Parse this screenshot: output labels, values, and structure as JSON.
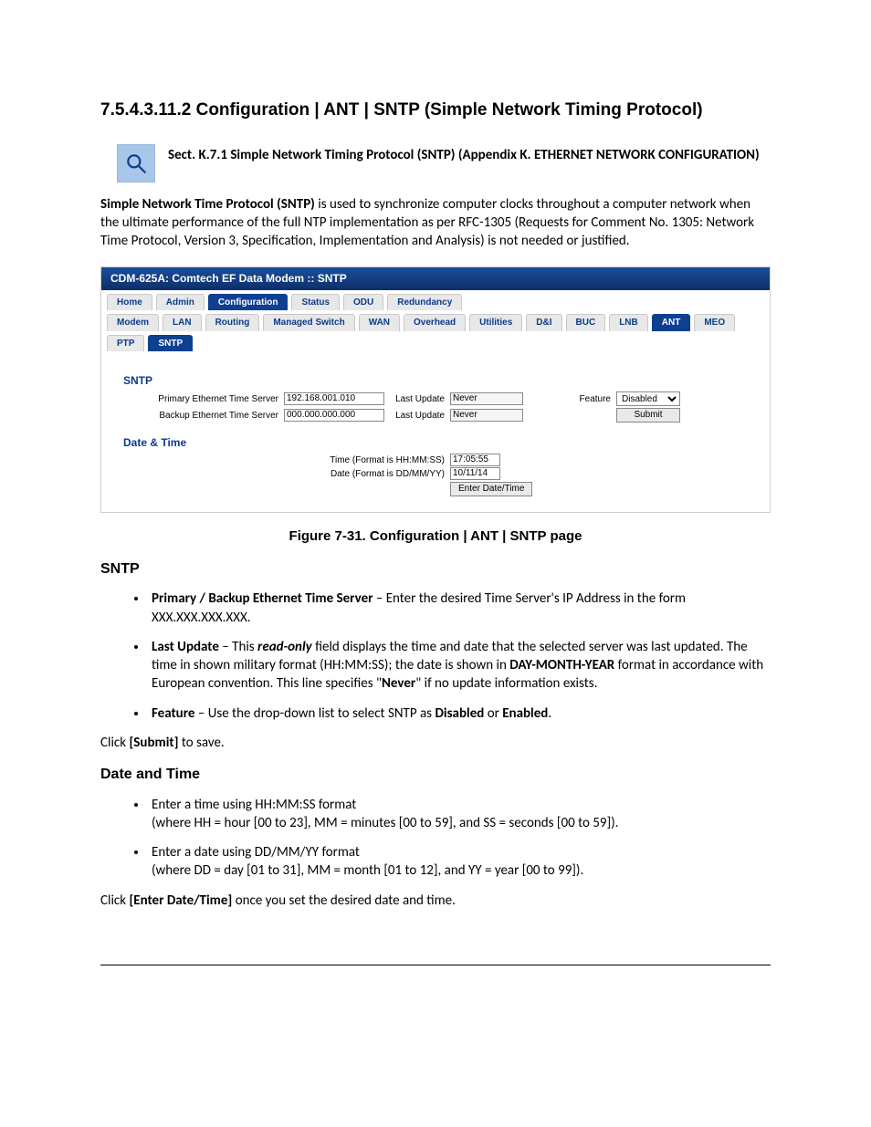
{
  "heading": "7.5.4.3.11.2 Configuration | ANT | SNTP (Simple Network Timing Protocol)",
  "callout_ref": "Sect. K.7.1 Simple Network Timing Protocol (SNTP) (Appendix K. ETHERNET NETWORK CONFIGURATION)",
  "intro_strong": "Simple Network Time Protocol (SNTP)",
  "intro_rest": " is used to synchronize computer clocks throughout a computer network when the ultimate performance of the full NTP implementation as per RFC-1305 (Requests for Comment No. 1305: Network Time Protocol, Version 3, Specification, Implementation and Analysis) is not needed or justified.",
  "figure_caption": "Figure 7-31. Configuration | ANT | SNTP page",
  "ss": {
    "title": "CDM-625A: Comtech EF Data Modem :: SNTP",
    "tabs_row1": [
      "Home",
      "Admin",
      "Configuration",
      "Status",
      "ODU",
      "Redundancy"
    ],
    "tabs_row1_active": 2,
    "tabs_row2": [
      "Modem",
      "LAN",
      "Routing",
      "Managed Switch",
      "WAN",
      "Overhead",
      "Utilities",
      "D&I",
      "BUC",
      "LNB",
      "ANT",
      "MEO"
    ],
    "tabs_row2_active": 10,
    "tabs_row3": [
      "PTP",
      "SNTP"
    ],
    "tabs_row3_active": 1,
    "sntp": {
      "section_label": "SNTP",
      "primary_label": "Primary Ethernet Time Server",
      "primary_value": "192.168.001.010",
      "backup_label": "Backup Ethernet Time Server",
      "backup_value": "000.000.000.000",
      "last_update_label": "Last Update",
      "last_update_primary": "Never",
      "last_update_backup": "Never",
      "feature_label": "Feature",
      "feature_selected": "Disabled",
      "submit_label": "Submit"
    },
    "dt": {
      "section_label": "Date & Time",
      "time_label": "Time (Format is HH:MM:SS)",
      "time_value": "17:05:55",
      "date_label": "Date (Format is DD/MM/YY)",
      "date_value": "10/11/14",
      "button_label": "Enter Date/Time"
    }
  },
  "sntp_heading": "SNTP",
  "bullet1_strong": "Primary / Backup Ethernet Time Server",
  "bullet1_rest": " – Enter the desired Time Server's IP Address in the form XXX.XXX.XXX.XXX.",
  "bullet2_strong": "Last Update",
  "bullet2_p1": " – This ",
  "bullet2_em": "read-only",
  "bullet2_p2": " field displays the time and date that the selected server was last updated. The time in shown military format (HH:MM:SS); the date is shown in ",
  "bullet2_strong2": "DAY-MONTH-YEAR",
  "bullet2_p3": " format in accordance with European convention. This line specifies \"",
  "bullet2_strong3": "Never",
  "bullet2_p4": "\" if no update information exists.",
  "bullet3_strong": "Feature",
  "bullet3_p1": " – Use the drop-down list to select SNTP as ",
  "bullet3_strong2": "Disabled",
  "bullet3_p2": " or ",
  "bullet3_strong3": "Enabled",
  "bullet3_p3": ".",
  "submit_line_a": "Click ",
  "submit_line_b": "[Submit]",
  "submit_line_c": " to save.",
  "dt_heading": "Date and Time",
  "dt_b1_l1": "Enter a time using HH:MM:SS format",
  "dt_b1_l2": "(where HH = hour [00 to 23], MM = minutes [00 to 59], and SS = seconds [00 to 59]).",
  "dt_b2_l1": "Enter a date using DD/MM/YY format",
  "dt_b2_l2": "(where DD = day [01 to 31], MM = month [01 to 12], and YY = year [00 to 99]).",
  "enter_line_a": "Click ",
  "enter_line_b": "[Enter Date/Time]",
  "enter_line_c": " once you set the desired date and time."
}
